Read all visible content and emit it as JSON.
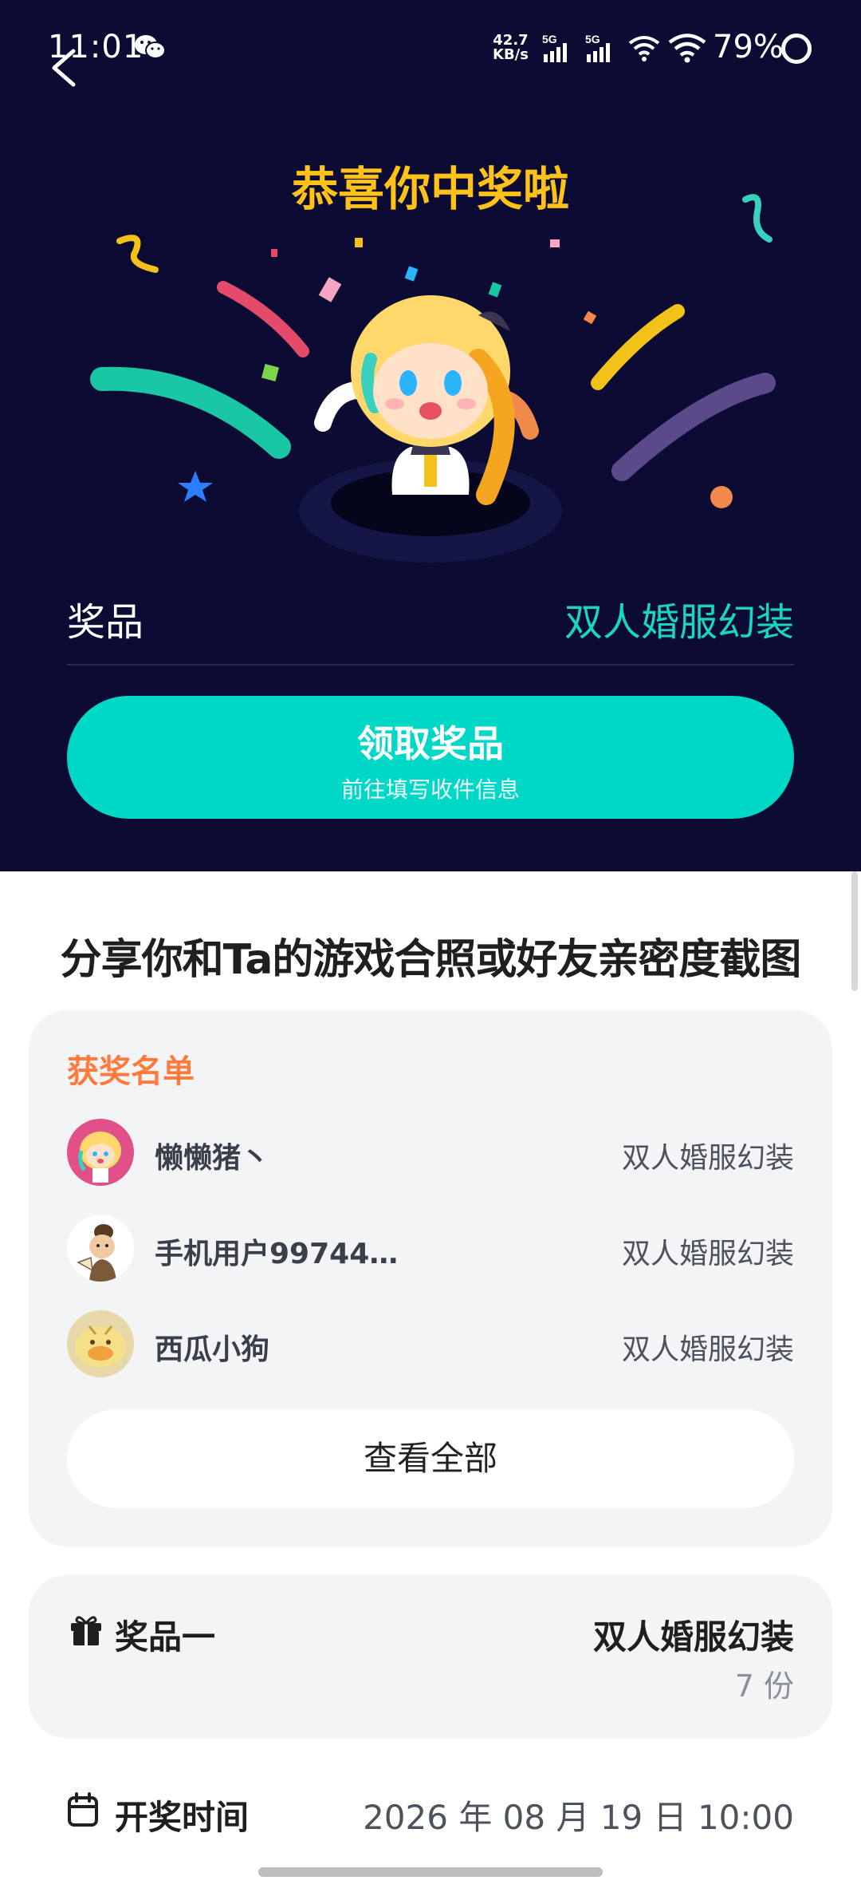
{
  "status_bar": {
    "time": "11:01",
    "net_speed_top": "42.7",
    "net_speed_bottom": "KB/s",
    "sig1": "5G",
    "sig2": "5G",
    "battery": "79%"
  },
  "hero": {
    "congrats": "恭喜你中奖啦",
    "prize_label": "奖品",
    "prize_value": "双人婚服幻装",
    "claim_title": "领取奖品",
    "claim_subtitle": "前往填写收件信息"
  },
  "share_title": "分享你和Ta的游戏合照或好友亲密度截图",
  "winners": {
    "title": "获奖名单",
    "rows": [
      {
        "name": "懒懒猪丶",
        "prize": "双人婚服幻装"
      },
      {
        "name": "手机用户99744…",
        "prize": "双人婚服幻装"
      },
      {
        "name": "西瓜小狗",
        "prize": "双人婚服幻装"
      }
    ],
    "view_all": "查看全部"
  },
  "prize_one": {
    "label": "奖品一",
    "name": "双人婚服幻装",
    "count": "7 份"
  },
  "draw": {
    "label": "开奖时间",
    "time": "2026 年 08 月 19 日 10:00"
  },
  "colors": {
    "hero_bg": "#0b0b33",
    "accent_teal": "#00d8c7",
    "gold": "#ffc21a",
    "orange": "#ff7a3d"
  }
}
